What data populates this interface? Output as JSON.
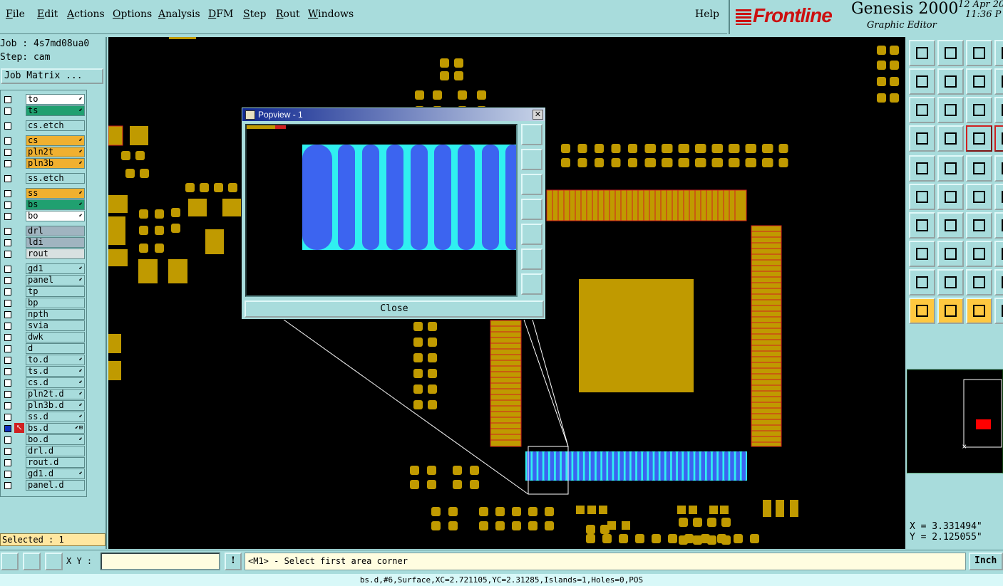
{
  "menu": {
    "items": [
      "File",
      "Edit",
      "Actions",
      "Options",
      "Analysis",
      "DFM",
      "Step",
      "Rout",
      "Windows"
    ],
    "help": "Help"
  },
  "brand": {
    "logo": "Frontline",
    "product": "Genesis 2000",
    "subtitle": "Graphic Editor",
    "date": "12 Apr 20",
    "time": "11:36 P"
  },
  "job": {
    "job_label": "Job : 4s7md08ua0",
    "step_label": "Step: cam",
    "matrix_button": "Job Matrix ..."
  },
  "layers": [
    {
      "name": "to",
      "color": "#ffffff",
      "mark": "⬋"
    },
    {
      "name": "ts",
      "color": "#20a070",
      "mark": "⬋"
    },
    {
      "name": "cs.etch",
      "color": "#a8dcdc",
      "mark": ""
    },
    {
      "name": "cs",
      "color": "#f0b030",
      "mark": "⬋"
    },
    {
      "name": "pln2t",
      "color": "#f0b030",
      "mark": "⬋"
    },
    {
      "name": "pln3b",
      "color": "#f0b030",
      "mark": "⬋"
    },
    {
      "name": "ss.etch",
      "color": "#a8dcdc",
      "mark": ""
    },
    {
      "name": "ss",
      "color": "#f0b030",
      "mark": "⬋"
    },
    {
      "name": "bs",
      "color": "#20a070",
      "mark": "⬋"
    },
    {
      "name": "bo",
      "color": "#ffffff",
      "mark": "⬋"
    },
    {
      "name": "drl",
      "color": "#a0b4c0",
      "mark": ""
    },
    {
      "name": "ldi",
      "color": "#a0b4c0",
      "mark": ""
    },
    {
      "name": "rout",
      "color": "#d8e0e0",
      "mark": ""
    },
    {
      "name": "gd1",
      "color": "#a8dcdc",
      "mark": "⬋"
    },
    {
      "name": "panel",
      "color": "#a8dcdc",
      "mark": "⬋"
    },
    {
      "name": "tp",
      "color": "#a8dcdc",
      "mark": ""
    },
    {
      "name": "bp",
      "color": "#a8dcdc",
      "mark": ""
    },
    {
      "name": "npth",
      "color": "#a8dcdc",
      "mark": ""
    },
    {
      "name": "svia",
      "color": "#a8dcdc",
      "mark": ""
    },
    {
      "name": "dwk",
      "color": "#a8dcdc",
      "mark": ""
    },
    {
      "name": "d",
      "color": "#a8dcdc",
      "mark": ""
    },
    {
      "name": "to.d",
      "color": "#a8dcdc",
      "mark": "⬋"
    },
    {
      "name": "ts.d",
      "color": "#a8dcdc",
      "mark": "⬋"
    },
    {
      "name": "cs.d",
      "color": "#a8dcdc",
      "mark": "⬋"
    },
    {
      "name": "pln2t.d",
      "color": "#a8dcdc",
      "mark": "⬋"
    },
    {
      "name": "pln3b.d",
      "color": "#a8dcdc",
      "mark": "⬋"
    },
    {
      "name": "ss.d",
      "color": "#a8dcdc",
      "mark": "⬋"
    },
    {
      "name": "bs.d",
      "color": "#a8dcdc",
      "mark": "⬋⊞"
    },
    {
      "name": "bo.d",
      "color": "#a8dcdc",
      "mark": "⬋"
    },
    {
      "name": "drl.d",
      "color": "#a8dcdc",
      "mark": ""
    },
    {
      "name": "rout.d",
      "color": "#a8dcdc",
      "mark": ""
    },
    {
      "name": "gd1.d",
      "color": "#a8dcdc",
      "mark": "⬋"
    },
    {
      "name": "panel.d",
      "color": "#a8dcdc",
      "mark": ""
    }
  ],
  "selected_label": "Selected : 1",
  "popview": {
    "title": "Popview - 1",
    "close_button": "Close"
  },
  "coords": {
    "x": "X = 3.331494\"",
    "y": "Y = 2.125055\""
  },
  "statusbar": {
    "xy_label": "X Y :",
    "xy_value": "",
    "prompt": "<M1> - Select first area corner",
    "unit": "Inch"
  },
  "info": "bs.d,#6,Surface,XC=2.721105,YC=2.31285,Islands=1,Holes=0,POS",
  "colors": {
    "background": "#a8dcdc",
    "pad": "#c09a00",
    "pad_outline": "#d02020",
    "highlight_pad": "#3c64f0",
    "highlight_space": "#30f0f0",
    "selected_bar": "#ffe7a0"
  }
}
